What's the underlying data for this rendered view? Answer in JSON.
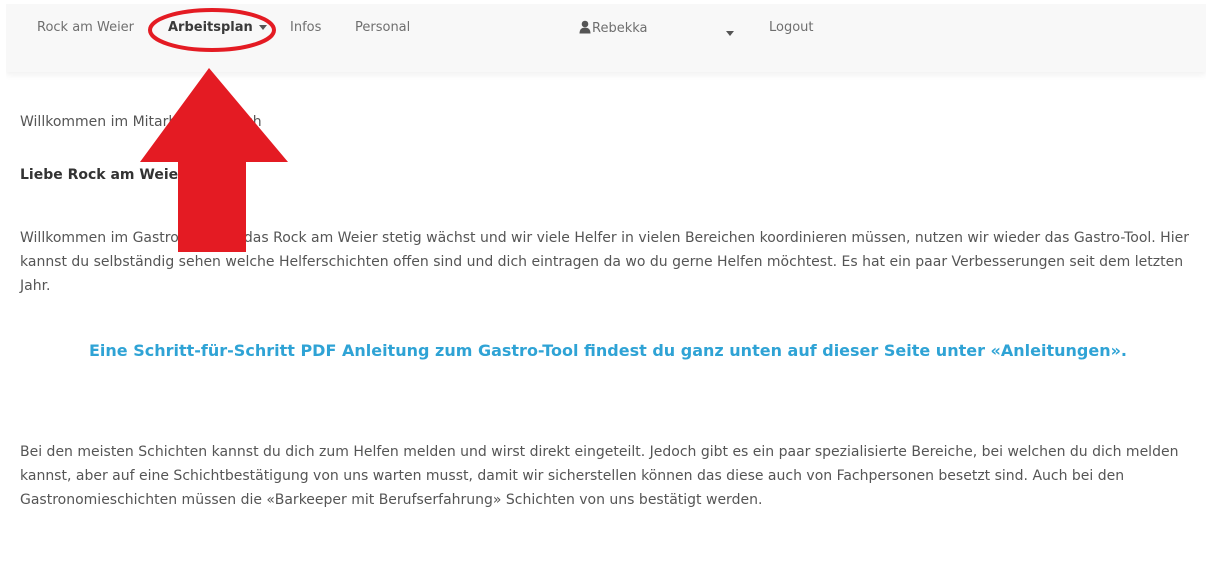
{
  "nav": {
    "brand": "Rock am Weier",
    "arbeitsplan": "Arbeitsplan",
    "infos": "Infos",
    "personal": "Personal",
    "user": "Rebekka",
    "logout": "Logout"
  },
  "content": {
    "welcome": "Willkommen im Mitarbeiterbereich",
    "greeting": "Liebe Rock am Weier Helfer",
    "intro": "Willkommen im Gastro-Tool! Da das Rock am Weier stetig wächst und wir viele Helfer in vielen Bereichen koordinieren müssen, nutzen wir wieder das Gastro-Tool. Hier kannst du selbständig sehen welche Helferschichten offen sind und dich eintragen da wo du gerne Helfen möchtest. Es hat ein paar Verbesserungen seit dem letzten Jahr.",
    "highlight": "Eine Schritt-für-Schritt PDF Anleitung zum Gastro-Tool findest du ganz unten auf dieser Seite unter «Anleitungen».",
    "info": "Bei den meisten Schichten kannst du dich zum Helfen melden und wirst direkt eingeteilt. Jedoch gibt es ein paar spezialisierte Bereiche, bei welchen du dich melden kannst, aber auf eine Schichtbestätigung von uns warten musst, damit wir sicherstellen können das diese auch von Fachpersonen besetzt sind. Auch bei den Gastronomieschichten müssen die «Barkeeper mit Berufserfahrung» Schichten von uns bestätigt werden."
  },
  "colors": {
    "annotation": "#e41b23",
    "highlight_text": "#2fa3d5"
  },
  "icons": {
    "user": "user-icon",
    "dropdown": "caret-down-icon"
  }
}
